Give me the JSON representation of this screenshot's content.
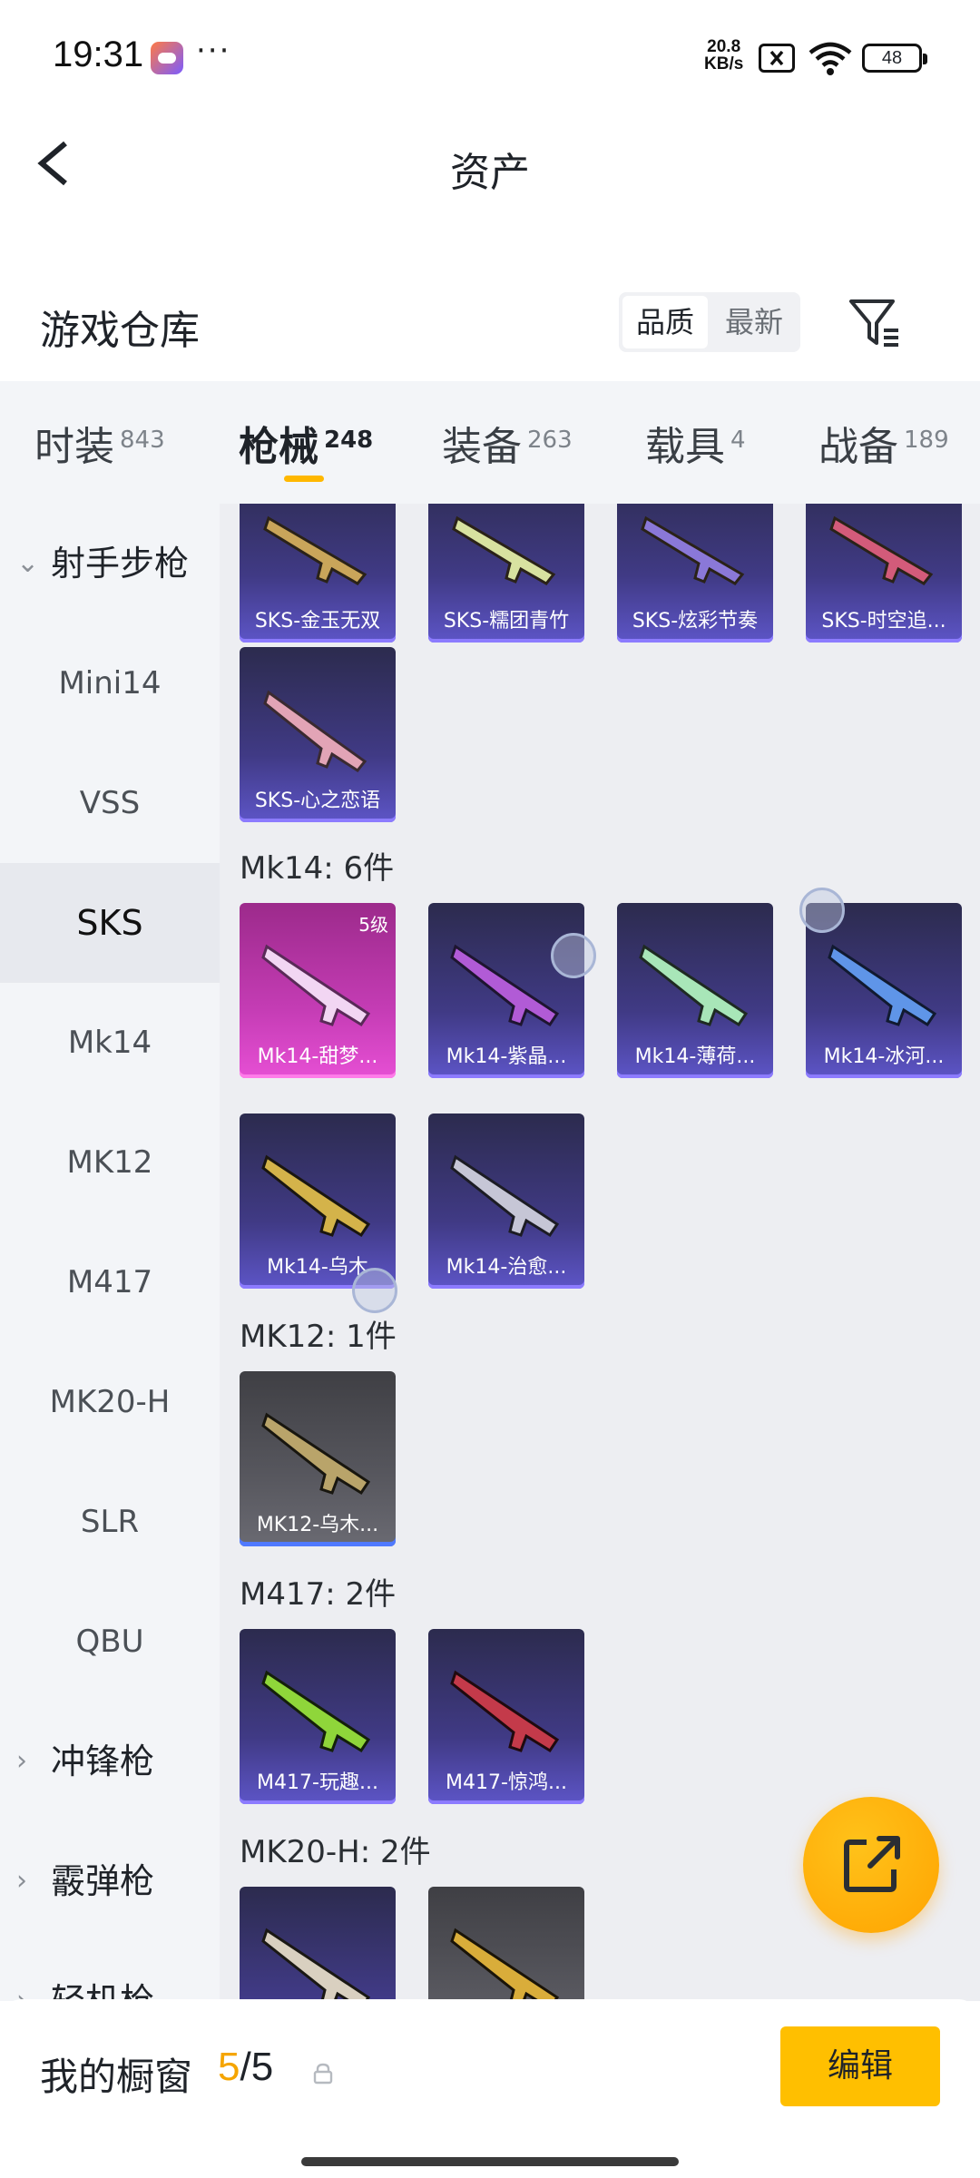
{
  "status": {
    "time": "19:31",
    "dots": "···",
    "speed_top": "20.8",
    "speed_unit": "KB/s",
    "battery": "48",
    "app_icon": "game-center-icon"
  },
  "nav": {
    "title": "资产",
    "back_icon": "back-arrow-icon"
  },
  "warehouse": {
    "title": "游戏仓库",
    "sort": [
      "品质",
      "最新"
    ],
    "filter_icon": "filter-icon"
  },
  "tabs": [
    {
      "label": "时装",
      "count": "843"
    },
    {
      "label": "枪械",
      "count": "248"
    },
    {
      "label": "装备",
      "count": "263"
    },
    {
      "label": "载具",
      "count": "4"
    },
    {
      "label": "战备",
      "count": "189"
    }
  ],
  "sidebar": {
    "category": "射手步枪",
    "items": [
      "Mini14",
      "VSS",
      "SKS",
      "Mk14",
      "MK12",
      "M417",
      "MK20-H",
      "SLR",
      "QBU"
    ],
    "collapsed": [
      "冲锋枪",
      "霰弹枪",
      "轻机枪"
    ]
  },
  "content": {
    "sks_cards": [
      "SKS-金玉无双",
      "SKS-糯团青竹",
      "SKS-炫彩节奏",
      "SKS-时空追...",
      "SKS-心之恋语"
    ],
    "mk14": {
      "title": "Mk14: 6件",
      "cards": [
        "Mk14-甜梦...",
        "Mk14-紫晶...",
        "Mk14-薄荷...",
        "Mk14-冰河...",
        "Mk14-乌木",
        "Mk14-治愈..."
      ],
      "level": "5级"
    },
    "mk12": {
      "title": "MK12: 1件",
      "cards": [
        "MK12-乌木..."
      ]
    },
    "m417": {
      "title": "M417: 2件",
      "cards": [
        "M417-玩趣...",
        "M417-惊鸿..."
      ]
    },
    "mk20": {
      "title": "MK20-H: 2件"
    }
  },
  "fab": {
    "icon": "share-icon"
  },
  "bottom": {
    "label": "我的橱窗",
    "current": "5",
    "total": "/5",
    "lock_icon": "lock-icon",
    "edit": "编辑"
  }
}
